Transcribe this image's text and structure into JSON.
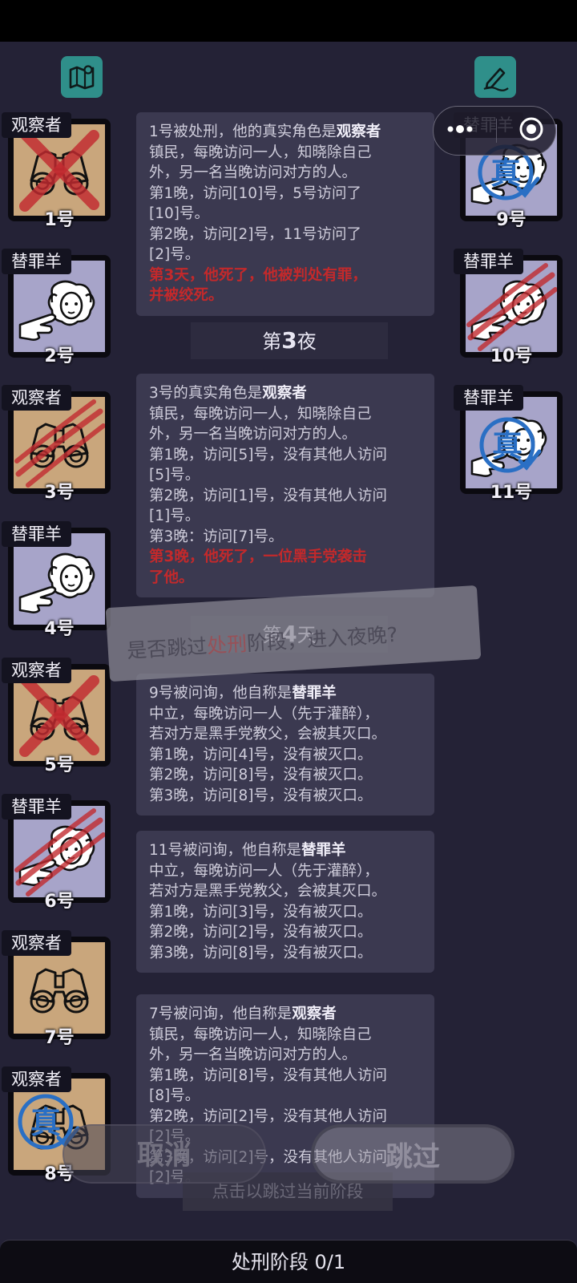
{
  "top_bar": {
    "map_icon": "map-icon",
    "notes_icon": "pencil-note-icon"
  },
  "capsule": {
    "more_icon": "more-dots-icon",
    "close_icon": "target-circle-icon"
  },
  "players_left": [
    {
      "role": "观察者",
      "num": "1号",
      "art": "binoculars",
      "status": "executed"
    },
    {
      "role": "替罪羊",
      "num": "2号",
      "art": "sheep",
      "status": "alive"
    },
    {
      "role": "观察者",
      "num": "3号",
      "art": "binoculars",
      "status": "killed"
    },
    {
      "role": "替罪羊",
      "num": "4号",
      "art": "sheep",
      "status": "alive"
    },
    {
      "role": "观察者",
      "num": "5号",
      "art": "binoculars",
      "status": "executed"
    },
    {
      "role": "替罪羊",
      "num": "6号",
      "art": "sheep",
      "status": "killed"
    },
    {
      "role": "观察者",
      "num": "7号",
      "art": "binoculars",
      "status": "alive"
    },
    {
      "role": "观察者",
      "num": "8号",
      "art": "binoculars",
      "status": "verified"
    }
  ],
  "players_right": [
    {
      "role": "替罪羊",
      "num": "9号",
      "art": "sheep",
      "status": "verified"
    },
    {
      "role": "替罪羊",
      "num": "10号",
      "art": "sheep",
      "status": "killed"
    },
    {
      "role": "替罪羊",
      "num": "11号",
      "art": "sheep",
      "status": "verified"
    }
  ],
  "verified_stamp": "真",
  "log": {
    "entry1": {
      "lead": "1号被处刑，他的真实角色是",
      "role": "观察者",
      "lines": [
        "镇民，每晚访问一人，知晓除自己",
        "外，另一名当晚访问对方的人。",
        "第1晚，访问[10]号，5号访问了",
        "[10]号。",
        "第2晚，访问[2]号，11号访问了",
        "[2]号。"
      ],
      "red": [
        "第3天，他死了，他被判处有罪，",
        "并被绞死。"
      ]
    },
    "phase1": {
      "pre": "第",
      "num": "3",
      "post": "夜"
    },
    "entry2": {
      "lead": "3号的真实角色是",
      "role": "观察者",
      "lines": [
        "镇民，每晚访问一人，知晓除自己",
        "外，另一名当晚访问对方的人。",
        "第1晚，访问[5]号，没有其他人访问",
        "[5]号。",
        "第2晚，访问[1]号，没有其他人访问",
        "[1]号。",
        "第3晚：访问[7]号。"
      ],
      "red": [
        "第3晚，他死了，一位黑手党袭击",
        "了他。"
      ]
    },
    "phase2": {
      "pre": "第",
      "num": "4",
      "post": "天"
    },
    "entry3": {
      "lead": "9号被问询，他自称是",
      "role": "替罪羊",
      "lines": [
        "中立，每晚访问一人（先于灌醉），",
        "若对方是黑手党教父，会被其灭口。",
        "第1晚，访问[4]号，没有被灭口。",
        "第2晚，访问[8]号，没有被灭口。",
        "第3晚，访问[8]号，没有被灭口。"
      ]
    },
    "entry4": {
      "lead": "11号被问询，他自称是",
      "role": "替罪羊",
      "lines": [
        "中立，每晚访问一人（先于灌醉），",
        "若对方是黑手党教父，会被其灭口。",
        "第1晚，访问[3]号，没有被灭口。",
        "第2晚，访问[2]号，没有被灭口。",
        "第3晚，访问[8]号，没有被灭口。"
      ]
    },
    "entry5": {
      "lead": "7号被问询，他自称是",
      "role": "观察者",
      "lines": [
        "镇民，每晚访问一人，知晓除自己",
        "外，另一名当晚访问对方的人。",
        "第1晚，访问[8]号，没有其他人访问",
        "[8]号。",
        "第2晚，访问[2]号，没有其他人访问",
        "[2]号。",
        "第3晚，访问[2]号，没有其他人访问",
        "[2]号。"
      ]
    }
  },
  "dialog": {
    "pre": "是否跳过",
    "highlight": "处刑",
    "post": "阶段，进入夜晚?",
    "cancel_label": "取消",
    "skip_label": "跳过",
    "hint": "点击以跳过当前阶段"
  },
  "bottom_bar": {
    "label": "处刑阶段 0/1"
  },
  "colors": {
    "background": "#242236",
    "log_box": "#3b3950",
    "red_text": "#c3292b",
    "tan_card": "#c9a67c",
    "lavender_card": "#a7a4c9",
    "stamp_blue": "#2a6fc4"
  }
}
